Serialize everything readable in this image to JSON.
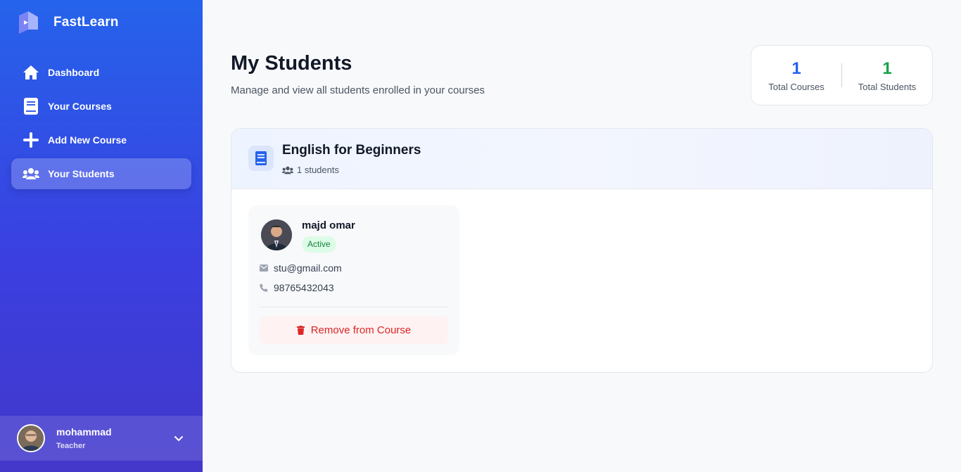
{
  "app": {
    "name": "FastLearn",
    "accent": "#2563eb"
  },
  "sidebar": {
    "items": [
      {
        "label": "Dashboard",
        "icon": "home-icon"
      },
      {
        "label": "Your Courses",
        "icon": "book-icon"
      },
      {
        "label": "Add New Course",
        "icon": "plus-icon"
      },
      {
        "label": "Your Students",
        "icon": "users-icon",
        "active": true
      }
    ],
    "user": {
      "name": "mohammad",
      "role": "Teacher"
    }
  },
  "header": {
    "title": "My Students",
    "subtitle": "Manage and view all students enrolled in your courses"
  },
  "stats": [
    {
      "value": "1",
      "label": "Total Courses",
      "color": "#2563eb"
    },
    {
      "value": "1",
      "label": "Total Students",
      "color": "#16a34a"
    }
  ],
  "course": {
    "title": "English for Beginners",
    "student_count": "1 students",
    "students": [
      {
        "name": "majd omar",
        "status": "Active",
        "email": "stu@gmail.com",
        "phone": "98765432043",
        "action": "Remove from Course"
      }
    ]
  }
}
